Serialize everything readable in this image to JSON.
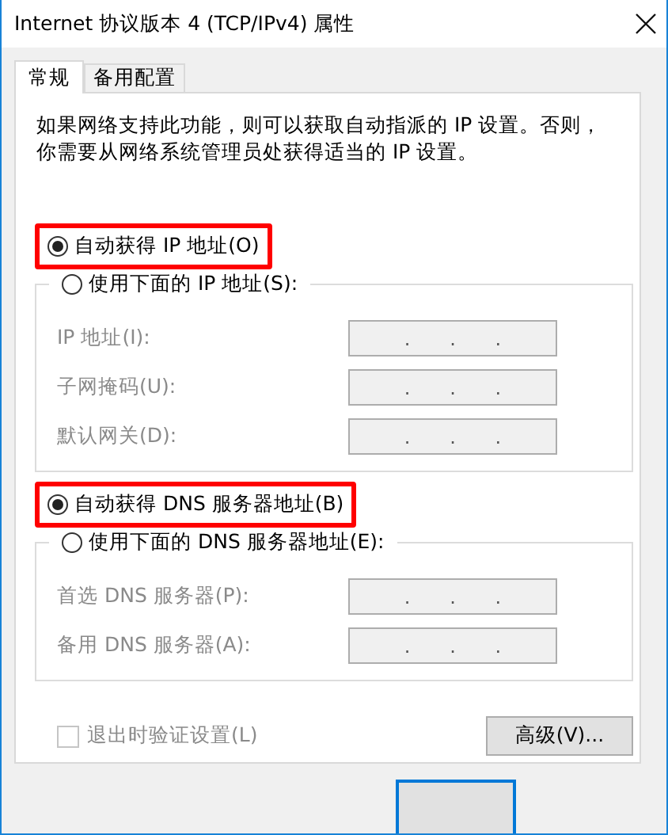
{
  "window": {
    "title": "Internet 协议版本 4 (TCP/IPv4) 属性"
  },
  "tabs": [
    {
      "label": "常规",
      "selected": true
    },
    {
      "label": "备用配置",
      "selected": false
    }
  ],
  "description": "如果网络支持此功能，则可以获取自动指派的 IP 设置。否则，你需要从网络系统管理员处获得适当的 IP 设置。",
  "ip_group": {
    "auto_option": {
      "label": "自动获得 IP 地址(O)",
      "selected": true,
      "highlighted": true
    },
    "manual_option": {
      "label": "使用下面的 IP 地址(S):",
      "selected": false
    },
    "fields": [
      {
        "label": "IP 地址(I):",
        "dots": [
          ".",
          ".",
          "."
        ],
        "disabled": true
      },
      {
        "label": "子网掩码(U):",
        "dots": [
          ".",
          ".",
          "."
        ],
        "disabled": true
      },
      {
        "label": "默认网关(D):",
        "dots": [
          ".",
          ".",
          "."
        ],
        "disabled": true
      }
    ]
  },
  "dns_group": {
    "auto_option": {
      "label": "自动获得 DNS 服务器地址(B)",
      "selected": true,
      "highlighted": true
    },
    "manual_option": {
      "label": "使用下面的 DNS 服务器地址(E):",
      "selected": false
    },
    "fields": [
      {
        "label": "首选 DNS 服务器(P):",
        "dots": [
          ".",
          ".",
          "."
        ],
        "disabled": true
      },
      {
        "label": "备用 DNS 服务器(A):",
        "dots": [
          ".",
          ".",
          "."
        ],
        "disabled": true
      }
    ]
  },
  "validate_checkbox": {
    "label": "退出时验证设置(L)",
    "checked": false,
    "disabled": true
  },
  "advanced_button": {
    "label": "高级(V)..."
  },
  "ok_button": {
    "focused": true
  }
}
